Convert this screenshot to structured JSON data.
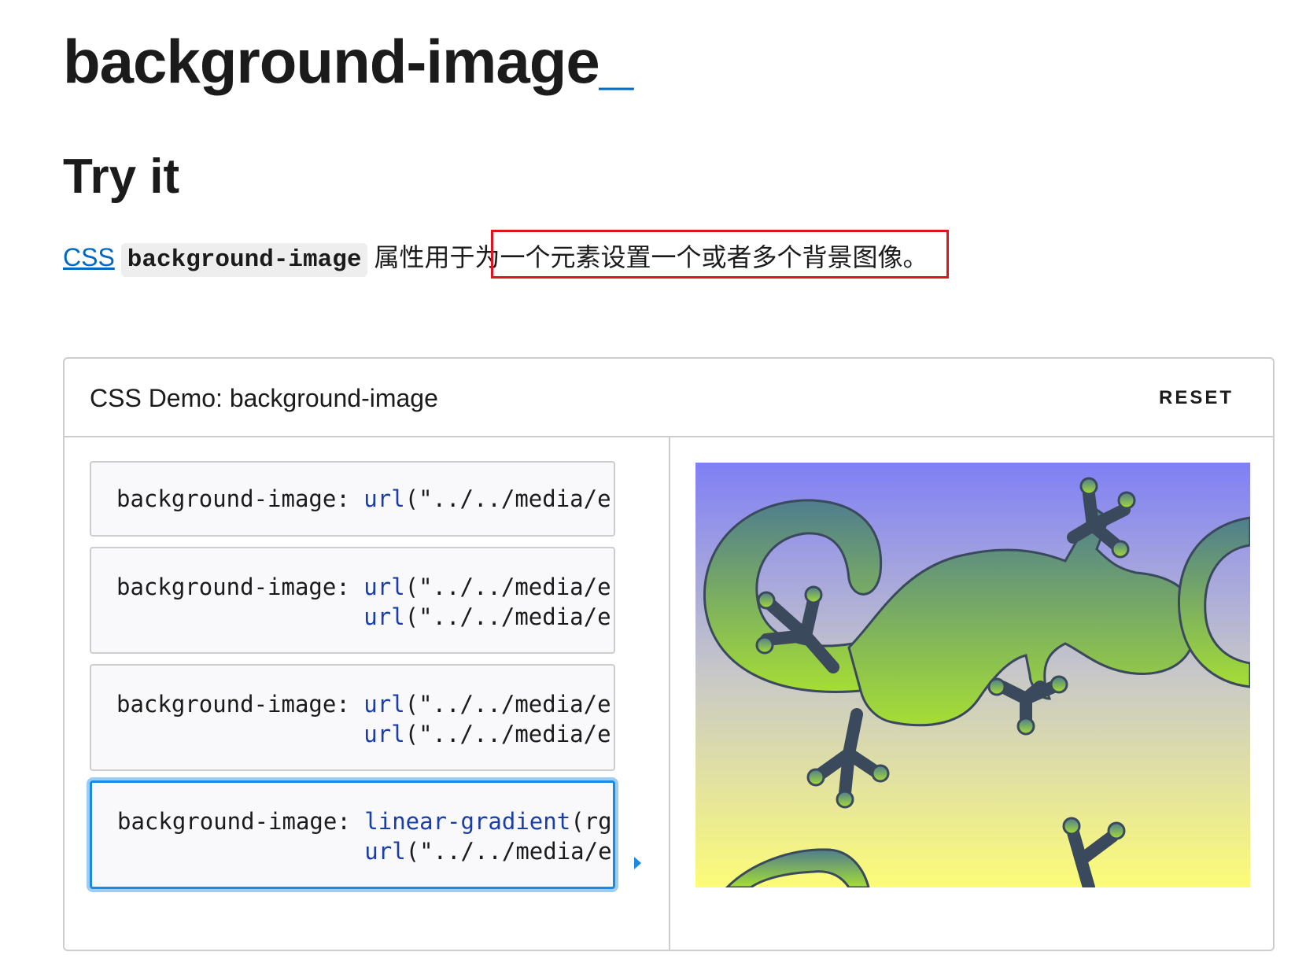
{
  "page": {
    "title": "background-image",
    "title_cursor": "_",
    "section_heading": "Try it",
    "intro": {
      "link_text": "CSS",
      "code_text": "background-image",
      "text_before_highlight": "属性用于",
      "text_highlighted": "为一个元素设置一个或者多个背景图像。"
    }
  },
  "demo": {
    "header_title": "CSS Demo: background-image",
    "reset_label": "RESET",
    "choices": [
      {
        "property": "background-image:",
        "lines": [
          {
            "fn": "url",
            "rest": "(\"../../media/e"
          }
        ],
        "selected": false
      },
      {
        "property": "background-image:",
        "lines": [
          {
            "fn": "url",
            "rest": "(\"../../media/e"
          },
          {
            "fn": "url",
            "rest": "(\"../../media/e"
          }
        ],
        "selected": false
      },
      {
        "property": "background-image:",
        "lines": [
          {
            "fn": "url",
            "rest": "(\"../../media/e"
          },
          {
            "fn": "url",
            "rest": "(\"../../media/e"
          }
        ],
        "selected": false
      },
      {
        "property": "background-image:",
        "lines": [
          {
            "fn": "linear-gradient",
            "rest": "(rg"
          },
          {
            "fn": "url",
            "rest": "(\"../../media/e"
          }
        ],
        "selected": true
      }
    ],
    "preview": {
      "image": "lizard-pattern",
      "gradient_top": "#7f7ff5",
      "gradient_mid": "#c8c8c8",
      "gradient_bottom": "#fcfc78",
      "lizard_fill_top": "#4f7d8e",
      "lizard_fill_bottom": "#a6de34",
      "lizard_stroke": "#3a4a5c"
    }
  },
  "colors": {
    "link": "#0069c2",
    "highlight_border": "#e0141e",
    "selected_border": "#1b8ae5",
    "code_keyword": "#1a3ea8"
  }
}
